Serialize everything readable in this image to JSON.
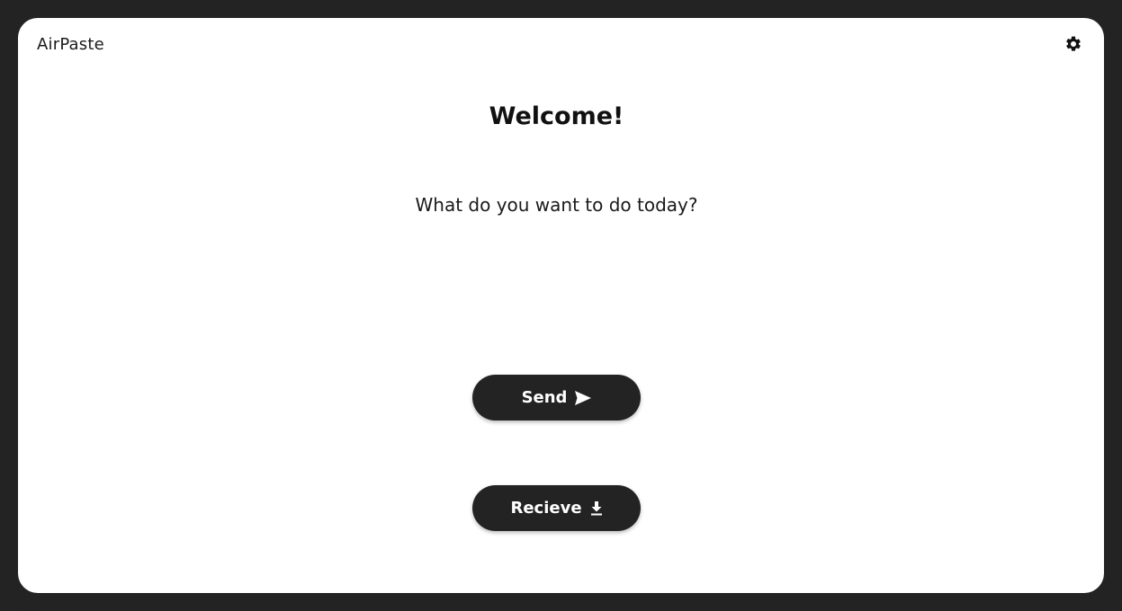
{
  "app": {
    "title": "AirPaste"
  },
  "header": {
    "settings_icon": "gear-icon"
  },
  "main": {
    "heading": "Welcome!",
    "prompt": "What do you want to do today?"
  },
  "actions": {
    "send_label": "Send",
    "send_icon": "send-arrow-icon",
    "receive_label": "Recieve",
    "receive_icon": "download-icon"
  },
  "colors": {
    "frame": "#232323",
    "window_bg": "#ffffff",
    "button_bg": "#232323",
    "button_text": "#ffffff",
    "text": "#111111"
  }
}
